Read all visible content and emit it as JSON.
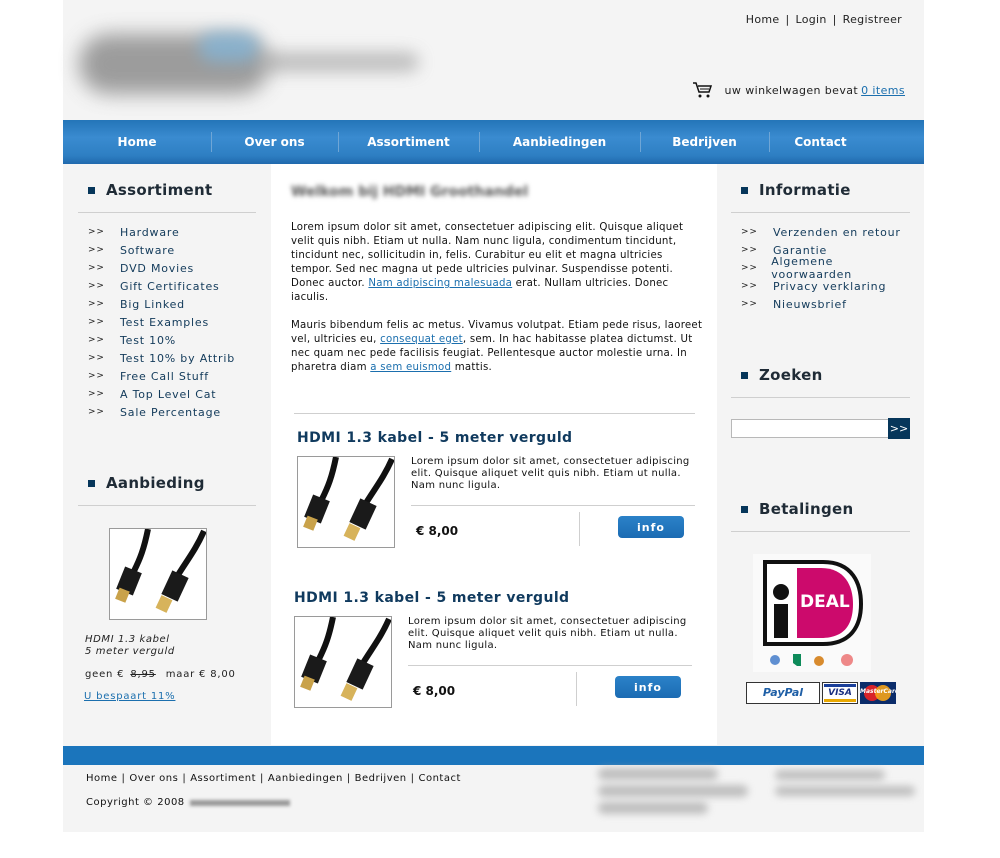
{
  "header": {
    "top_links": [
      "Home",
      "Login",
      "Registreer"
    ],
    "cart_text": "uw winkelwagen bevat",
    "cart_link": "0 items"
  },
  "nav": {
    "items": [
      "Home",
      "Over ons",
      "Assortiment",
      "Aanbiedingen",
      "Bedrijven",
      "Contact"
    ]
  },
  "left": {
    "assortiment_title": "Assortiment",
    "arrow": ">>",
    "categories": [
      "Hardware",
      "Software",
      "DVD Movies",
      "Gift Certificates",
      "Big Linked",
      "Test Examples",
      "Test 10%",
      "Test 10% by Attrib",
      "Free Call Stuff",
      "A Top Level Cat",
      "Sale Percentage"
    ],
    "aanbieding_title": "Aanbieding",
    "offer": {
      "name_line1": "HDMI 1.3 kabel",
      "name_line2": "5 meter verguld",
      "old_prefix": "geen €",
      "old_price": "8,95",
      "new_price": "maar € 8,00",
      "savings": "U bespaart 11%"
    }
  },
  "center": {
    "welcome_title": "Welkom bij HDMI Groothandel",
    "p1_a": "Lorem ipsum dolor sit amet, consectetuer adipiscing elit. Quisque aliquet velit quis nibh. Etiam ut nulla. Nam nunc ligula, condimentum tincidunt, tincidunt nec, sollicitudin in, felis. Curabitur eu elit et magna ultricies tempor. Sed nec magna ut pede ultricies pulvinar. Suspendisse potenti. Donec auctor. ",
    "p1_link": "Nam adipiscing malesuada",
    "p1_b": " erat. Nullam ultricies. Donec iaculis.",
    "p2_a": "Mauris bibendum felis ac metus. Vivamus volutpat. Etiam pede risus, laoreet vel, ultricies eu, ",
    "p2_link1": "consequat eget",
    "p2_b": ", sem. In hac habitasse platea dictumst. Ut nec quam nec pede facilisis feugiat. Pellentesque auctor molestie urna. In pharetra diam ",
    "p2_link2": " a sem euismod",
    "p2_c": " mattis.",
    "products": [
      {
        "title": "HDMI 1.3 kabel - 5 meter verguld",
        "desc": "Lorem ipsum dolor sit amet, consectetuer adipiscing elit. Quisque aliquet velit quis nibh. Etiam ut nulla. Nam nunc ligula.",
        "price": "€ 8,00",
        "button": "info"
      },
      {
        "title": "HDMI 1.3 kabel - 5 meter verguld",
        "desc": "Lorem ipsum dolor sit amet, consectetuer adipiscing elit. Quisque aliquet velit quis nibh. Etiam ut nulla. Nam nunc ligula.",
        "price": "€ 8,00",
        "button": "info"
      }
    ]
  },
  "right": {
    "informatie_title": "Informatie",
    "arrow": ">>",
    "info_links": [
      "Verzenden en retour",
      "Garantie",
      "Algemene voorwaarden",
      "Privacy verklaring",
      "Nieuwsbrief"
    ],
    "zoeken_title": "Zoeken",
    "search_value": "",
    "search_button": ">>",
    "betalingen_title": "Betalingen",
    "ideal_text": "DEAL",
    "paypal": "PayPal",
    "visa": "VISA",
    "mastercard": "MasterCard"
  },
  "footer": {
    "links": [
      "Home",
      "Over ons",
      "Assortiment",
      "Aanbiedingen",
      "Bedrijven",
      "Contact"
    ],
    "copyright": "Copyright © 2008"
  },
  "colors": {
    "nav_blue": "#2e7fc3",
    "footer_blue": "#1b75bc",
    "dark_navy": "#06365a",
    "link_blue": "#1b6fae",
    "page_bg": "#f4f4f4"
  }
}
